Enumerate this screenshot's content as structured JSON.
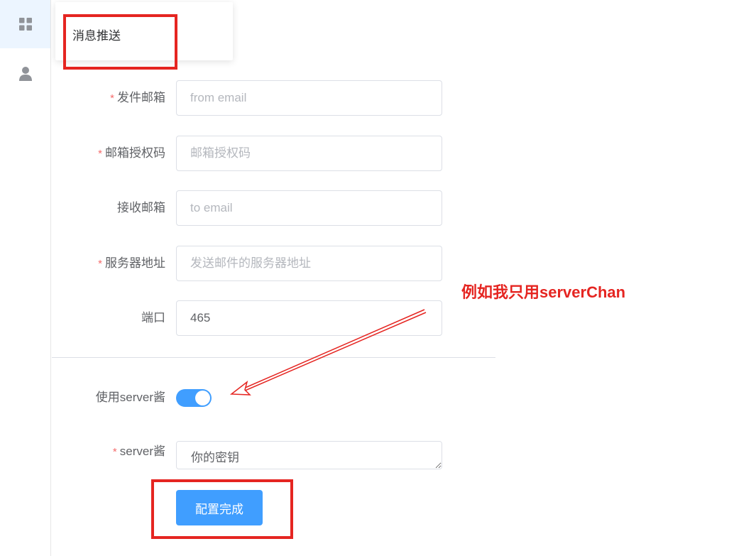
{
  "sidebar": {
    "items": [
      {
        "icon": "grid-icon",
        "active": true
      },
      {
        "icon": "user-icon",
        "active": false
      }
    ]
  },
  "menu": {
    "title": "消息推送"
  },
  "form": {
    "from_email": {
      "label": "发件邮箱",
      "required": true,
      "placeholder": "from email",
      "value": ""
    },
    "auth_code": {
      "label": "邮箱授权码",
      "required": true,
      "placeholder": "邮箱授权码",
      "value": ""
    },
    "to_email": {
      "label": "接收邮箱",
      "required": false,
      "placeholder": "to email",
      "value": ""
    },
    "server_addr": {
      "label": "服务器地址",
      "required": true,
      "placeholder": "发送邮件的服务器地址",
      "value": ""
    },
    "port": {
      "label": "端口",
      "required": false,
      "placeholder": "",
      "value": "465"
    },
    "use_serverchan": {
      "label": "使用server酱",
      "enabled": true
    },
    "serverchan_key": {
      "label": "server酱",
      "required": true,
      "placeholder": "你的密钥",
      "value": ""
    },
    "submit_label": "配置完成"
  },
  "annotation": {
    "text": "例如我只用serverChan",
    "color": "#e52521"
  },
  "colors": {
    "primary": "#409eff",
    "required": "#f56c6c",
    "annotation": "#e52521"
  }
}
